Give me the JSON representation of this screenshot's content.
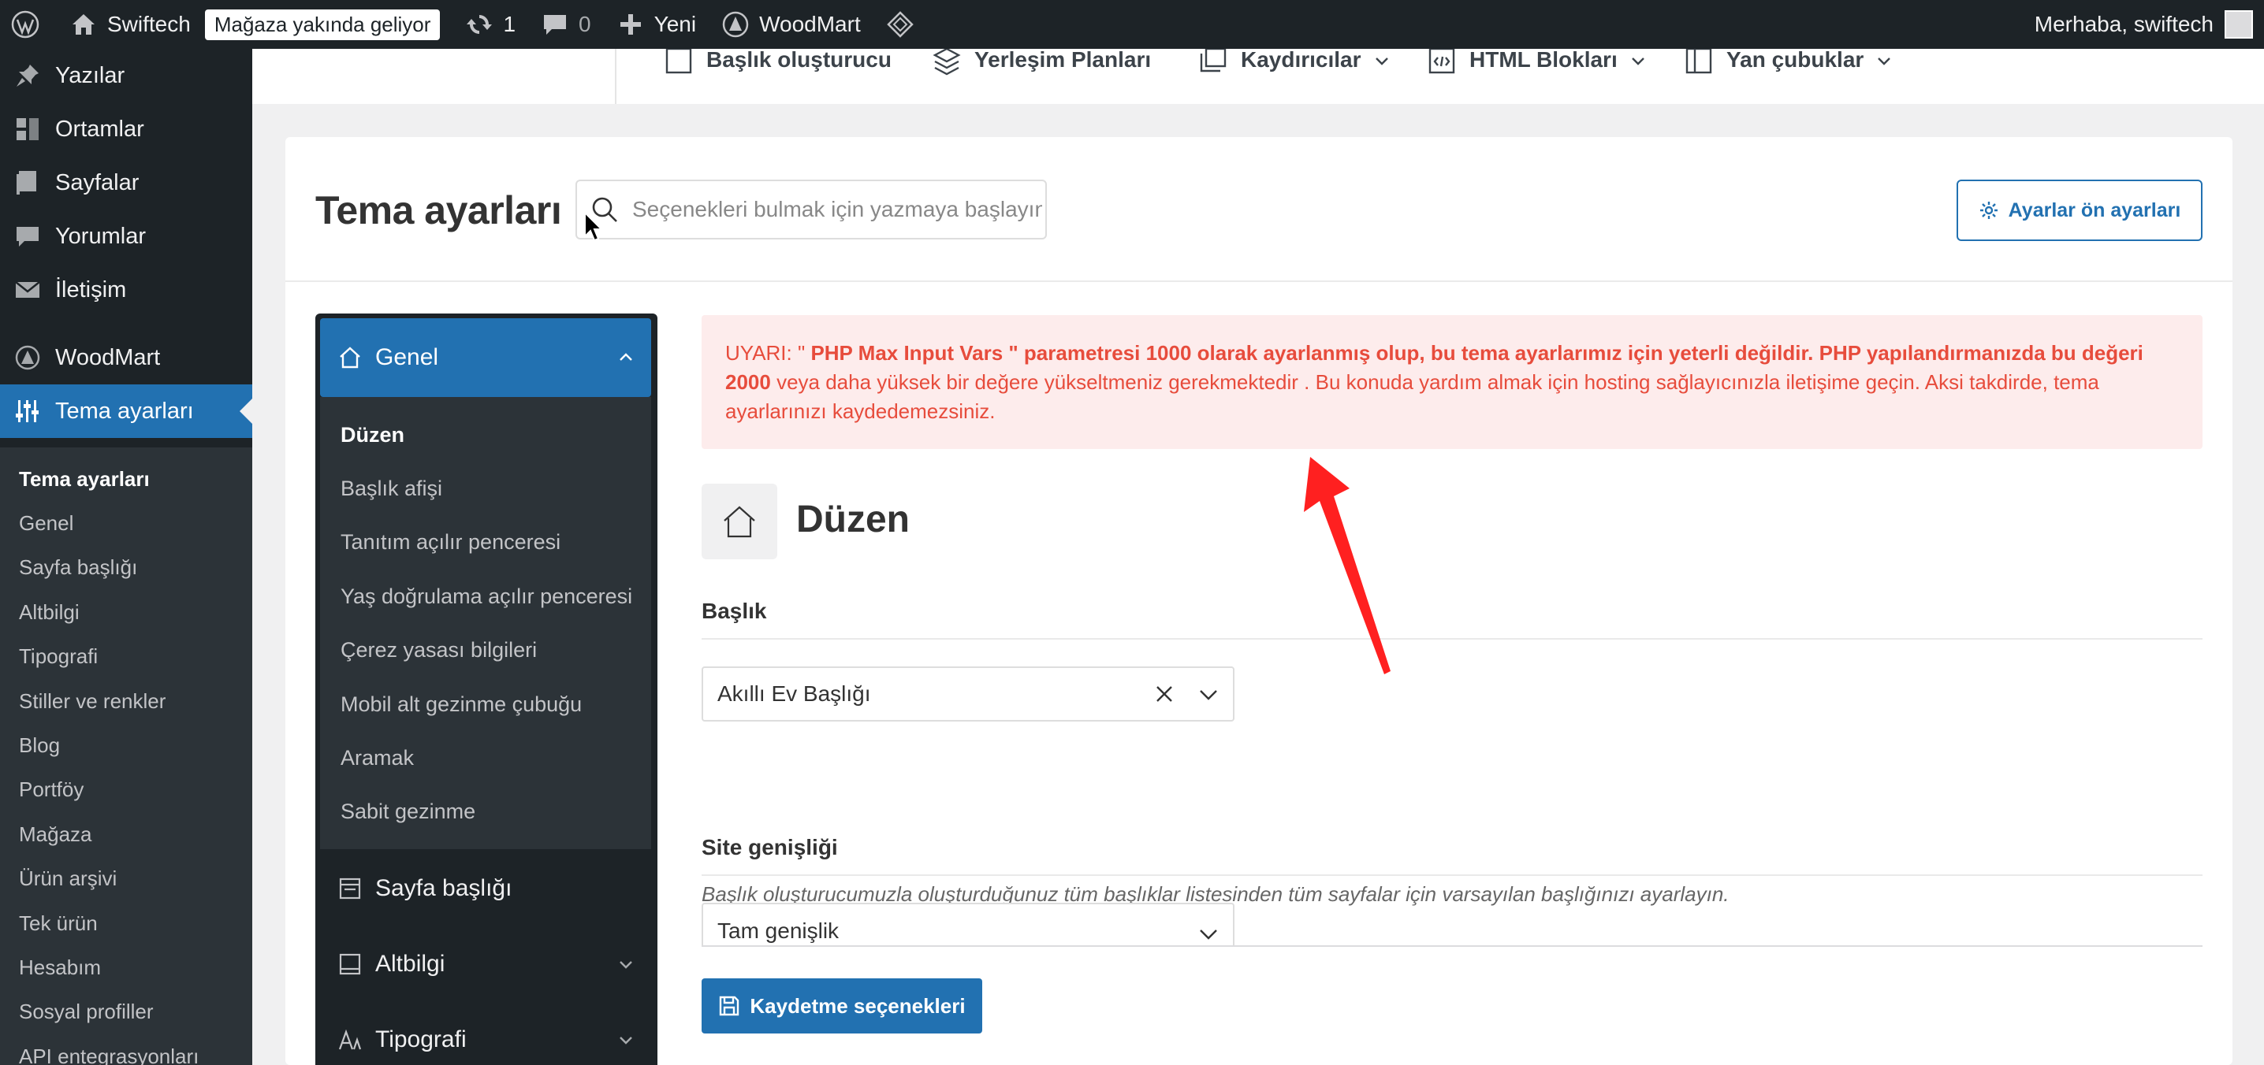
{
  "admin_bar": {
    "site_name": "Swiftech",
    "coming_soon": "Mağaza yakında geliyor",
    "updates_count": "1",
    "comments_count": "0",
    "new_label": "Yeni",
    "theme_name": "WoodMart",
    "greeting": "Merhaba, swiftech"
  },
  "admin_menu": {
    "items": [
      {
        "label": "Yazılar",
        "icon": "pin-icon"
      },
      {
        "label": "Ortamlar",
        "icon": "media-icon"
      },
      {
        "label": "Sayfalar",
        "icon": "pages-icon"
      },
      {
        "label": "Yorumlar",
        "icon": "comment-icon"
      },
      {
        "label": "İletişim",
        "icon": "mail-icon"
      },
      {
        "label": "WoodMart",
        "icon": "woodmart-icon"
      },
      {
        "label": "Tema ayarları",
        "icon": "sliders-icon"
      }
    ],
    "submenu": [
      "Tema ayarları",
      "Genel",
      "Sayfa başlığı",
      "Altbilgi",
      "Tipografi",
      "Stiller ve renkler",
      "Blog",
      "Portföy",
      "Mağaza",
      "Ürün arşivi",
      "Tek ürün",
      "Hesabım",
      "Sosyal profiller",
      "API entegrasyonları"
    ]
  },
  "top_nav": {
    "items": [
      "Başlık oluşturucu",
      "Yerleşim Planları",
      "Kaydırıcılar",
      "HTML Blokları",
      "Yan çubuklar"
    ]
  },
  "settings": {
    "title": "Tema ayarları",
    "search_placeholder": "Seçenekleri bulmak için yazmaya başlayın",
    "presets_label": "Ayarlar ön ayarları",
    "nav": {
      "genel": "Genel",
      "genel_items": [
        "Düzen",
        "Başlık afişi",
        "Tanıtım açılır penceresi",
        "Yaş doğrulama açılır penceresi",
        "Çerez yasası bilgileri",
        "Mobil alt gezinme çubuğu",
        "Aramak",
        "Sabit gezinme"
      ],
      "sayfa_basligi": "Sayfa başlığı",
      "altbilgi": "Altbilgi",
      "tipografi": "Tipografi"
    },
    "warning": {
      "prefix": "UYARI: \"",
      "bold1": " PHP Max Input Vars \" parametresi 1000 olarak ayarlanmış olup, bu tema ayarlarımız için yeterli değildir. PHP yapılandırmanızda bu değeri 2000",
      "rest": " veya daha yüksek bir değere yükseltmeniz gerekmektedir . Bu konuda yardım almak için hosting sağlayıcınızla iletişime geçin. Aksi takdirde, tema ayarlarınızı kaydedemezsiniz."
    },
    "section_title": "Düzen",
    "header_label": "Başlık",
    "header_value": "Akıllı Ev Başlığı",
    "header_desc": "Başlık oluşturucumuzla oluşturduğunuz tüm başlıklar listesinden tüm sayfalar için varsayılan başlığınızı ayarlayın.",
    "width_label": "Site genişliği",
    "width_value": "Tam genişlik",
    "save_label": "Kaydetme seçenekleri"
  },
  "colors": {
    "accent": "#2271b1",
    "admin_dark": "#1d2327",
    "warning_text": "#e74c3c",
    "warning_bg": "#fdecec",
    "annotation": "#ff2020"
  }
}
